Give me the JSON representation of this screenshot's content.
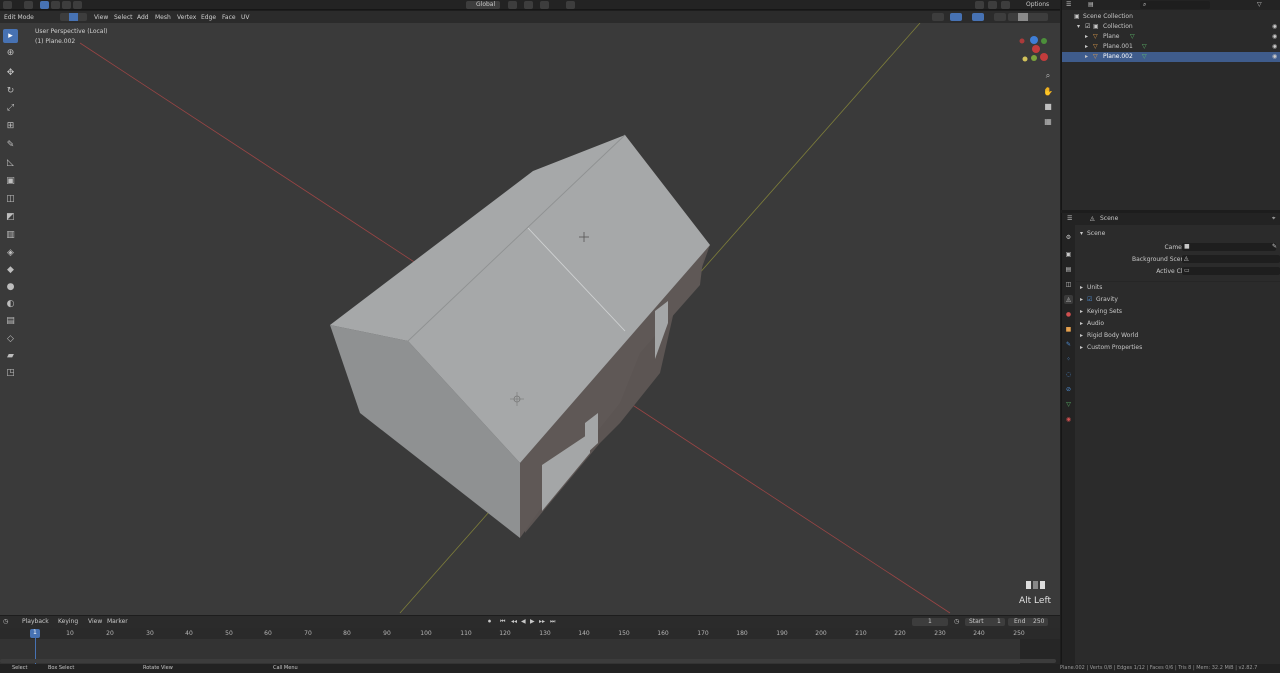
{
  "header": {
    "mode": "Edit Mode",
    "menus": [
      "View",
      "Select",
      "Add",
      "Mesh",
      "Vertex",
      "Edge",
      "Face",
      "UV"
    ],
    "transform_orientation": "Global",
    "options": "Options"
  },
  "viewport": {
    "view_name": "User Perspective (Local)",
    "object_name": "(1) Plane.002",
    "key_hint": "Alt Left",
    "colors": {
      "background": "#3a3a3a",
      "x_axis": "#b04b4b",
      "y_axis": "#8b8b3d",
      "mesh_light": "#a6a8a9",
      "mesh_mid": "#8f9192",
      "mesh_dark": "#5c5553"
    }
  },
  "timeline": {
    "menus": [
      "Playback",
      "Keying",
      "View",
      "Marker"
    ],
    "current_frame": "1",
    "start_label": "Start",
    "start_value": "1",
    "end_label": "End",
    "end_value": "250",
    "ruler_ticks": [
      "10",
      "20",
      "30",
      "40",
      "50",
      "60",
      "70",
      "80",
      "90",
      "100",
      "110",
      "120",
      "130",
      "140",
      "150",
      "160",
      "170",
      "180",
      "190",
      "200",
      "210",
      "220",
      "230",
      "240",
      "250"
    ],
    "current_marker": "1"
  },
  "statusbar": {
    "items": [
      "Select",
      "Box Select",
      "Rotate View",
      "Call Menu"
    ],
    "stats": "Plane.002 | Verts 0/8 | Edges 1/12 | Faces 0/6 | Tris 8 | Mem: 32.2 MiB | v2.82.7"
  },
  "outliner": {
    "root": "Scene Collection",
    "collection": "Collection",
    "items": [
      {
        "label": "Plane",
        "selected": false
      },
      {
        "label": "Plane.001",
        "selected": false
      },
      {
        "label": "Plane.002",
        "selected": true
      }
    ]
  },
  "properties": {
    "context": "Scene",
    "section": "Scene",
    "fields": [
      {
        "label": "Camera"
      },
      {
        "label": "Background Scene"
      },
      {
        "label": "Active Clip"
      }
    ],
    "panels": [
      "Units",
      "Gravity",
      "Keying Sets",
      "Audio",
      "Rigid Body World",
      "Custom Properties"
    ]
  }
}
